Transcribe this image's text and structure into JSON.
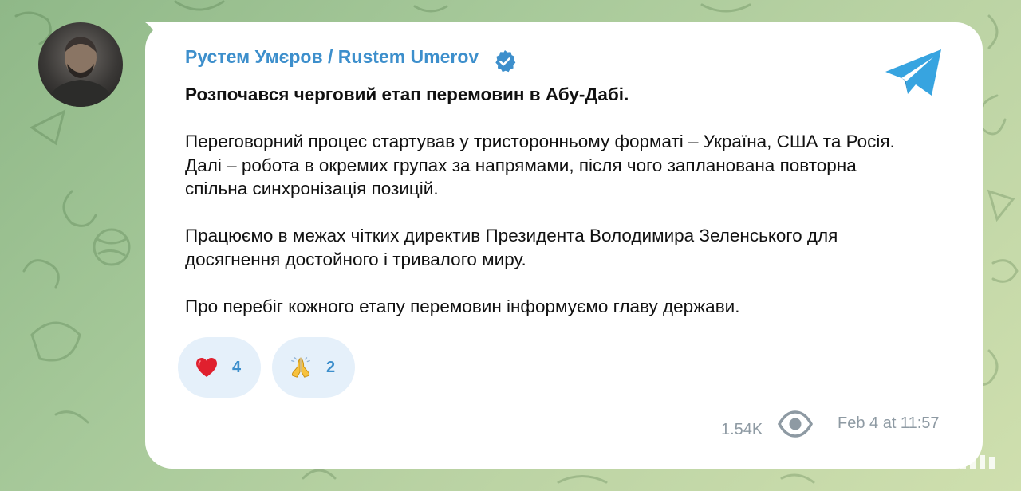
{
  "channel": {
    "sender_name": "Рустем Умєров / Rustem Umerov",
    "verified_icon": "verified-badge-icon",
    "app_logo_icon": "telegram-logo-icon",
    "accent_color": "#3d8fcc"
  },
  "message": {
    "headline": "Розпочався черговий етап перемовин в Абу-Дабі.",
    "paragraphs": [
      "Переговорний процес стартував у тристоронньому форматі – Україна, США та Росія. Далі – робота в окремих групах за напрямами, після чого запланована повторна спільна синхронізація позицій.",
      "Працюємо в межах чітких директив Президента Володимира Зеленського для досягнення достойного і тривалого миру.",
      "Про перебіг кожного етапу перемовин інформуємо главу держави."
    ]
  },
  "reactions": [
    {
      "emoji_icon": "red-heart-icon",
      "count": "4"
    },
    {
      "emoji_icon": "folded-hands-icon",
      "count": "2"
    }
  ],
  "footer": {
    "views": "1.54K",
    "views_icon": "eye-icon",
    "timestamp": "Feb 4 at 11:57"
  }
}
